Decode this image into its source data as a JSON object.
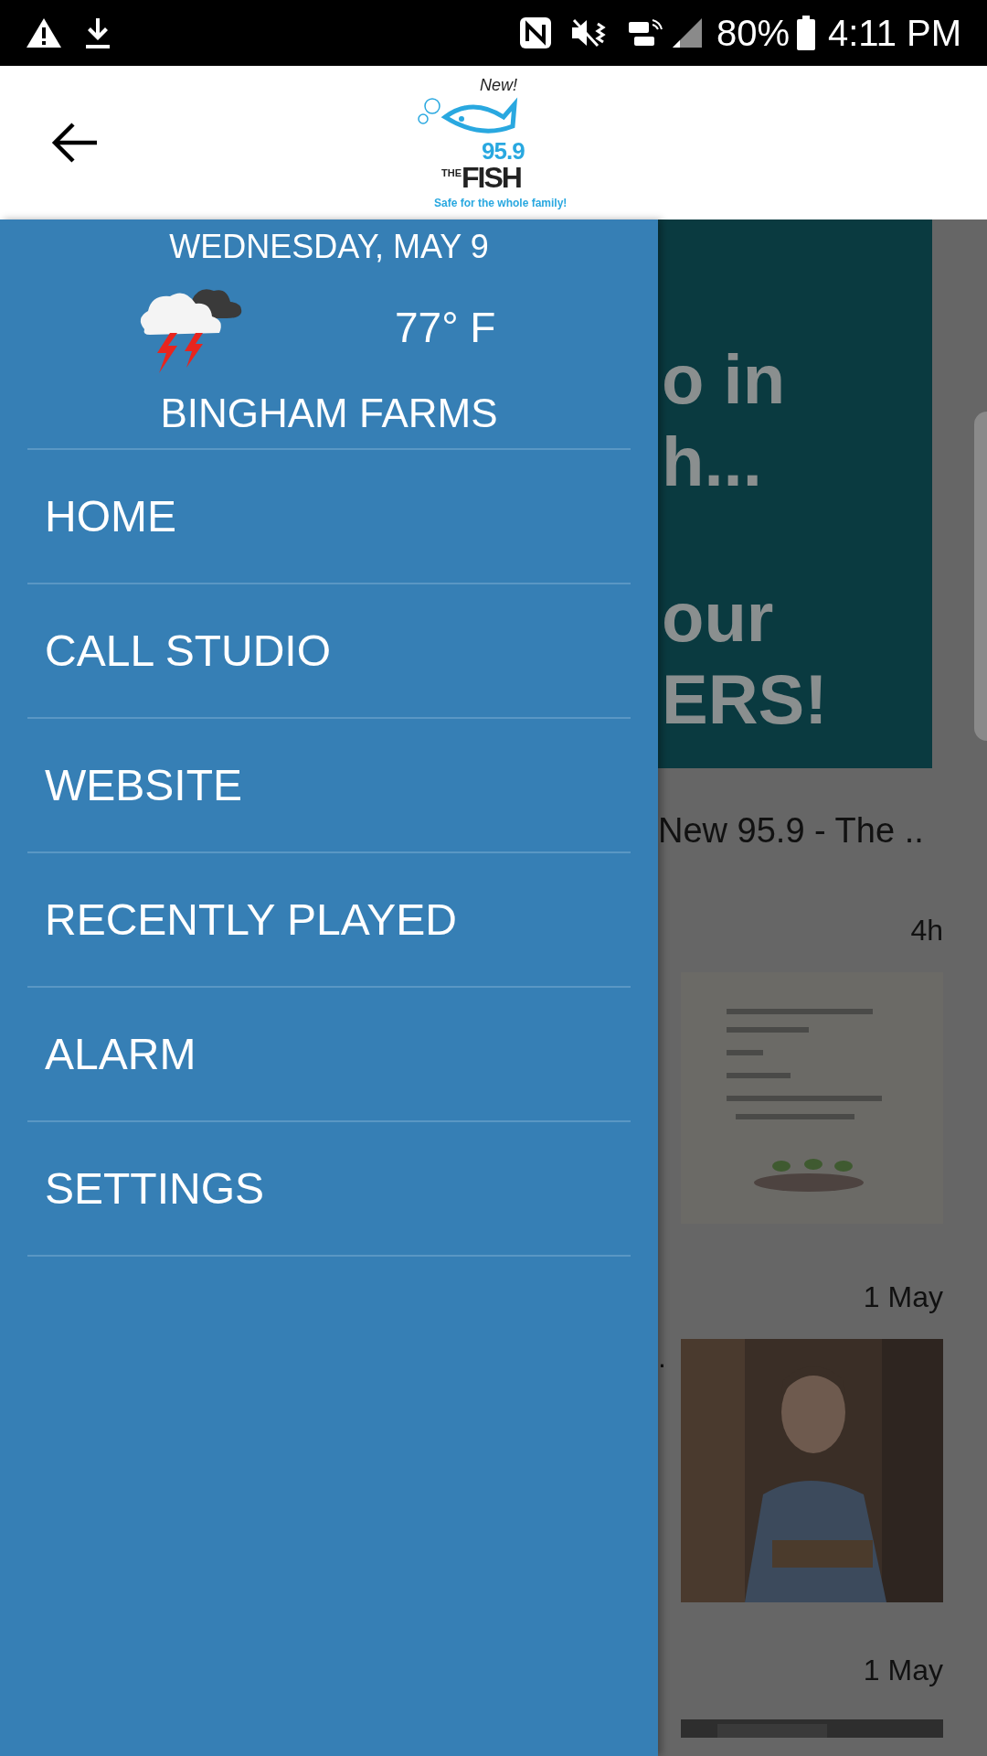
{
  "status_bar": {
    "battery": "80%",
    "time": "4:11 PM"
  },
  "header": {
    "logo": {
      "badge": "New!",
      "number": "95.9",
      "the": "THE",
      "name": "FISH",
      "tagline": "Safe for the whole family!"
    }
  },
  "drawer": {
    "date": "WEDNESDAY, MAY 9",
    "temperature": "77° F",
    "location": "BINGHAM FARMS",
    "items": [
      {
        "label": "HOME"
      },
      {
        "label": "CALL STUDIO"
      },
      {
        "label": "WEBSITE"
      },
      {
        "label": "RECENTLY PLAYED"
      },
      {
        "label": "ALARM"
      },
      {
        "label": "SETTINGS"
      }
    ]
  },
  "background": {
    "banner_lines": [
      "o in",
      "h...",
      "our",
      "ERS!"
    ],
    "title": "New 95.9 - The ..",
    "posts": [
      {
        "time": "4h",
        "kind": "picture"
      },
      {
        "time": "1 May",
        "kind": "picture"
      }
    ],
    "trailing_text": ".",
    "last_time": "1 May"
  }
}
